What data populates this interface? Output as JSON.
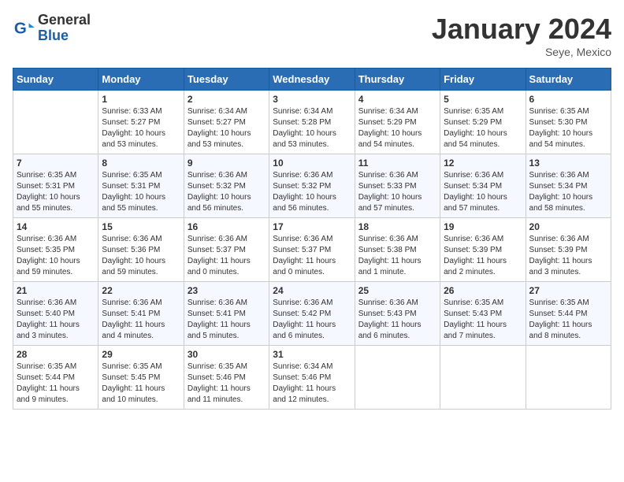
{
  "header": {
    "logo_line1": "General",
    "logo_line2": "Blue",
    "month_title": "January 2024",
    "location": "Seye, Mexico"
  },
  "days_of_week": [
    "Sunday",
    "Monday",
    "Tuesday",
    "Wednesday",
    "Thursday",
    "Friday",
    "Saturday"
  ],
  "weeks": [
    [
      {
        "day": "",
        "info": ""
      },
      {
        "day": "1",
        "info": "Sunrise: 6:33 AM\nSunset: 5:27 PM\nDaylight: 10 hours\nand 53 minutes."
      },
      {
        "day": "2",
        "info": "Sunrise: 6:34 AM\nSunset: 5:27 PM\nDaylight: 10 hours\nand 53 minutes."
      },
      {
        "day": "3",
        "info": "Sunrise: 6:34 AM\nSunset: 5:28 PM\nDaylight: 10 hours\nand 53 minutes."
      },
      {
        "day": "4",
        "info": "Sunrise: 6:34 AM\nSunset: 5:29 PM\nDaylight: 10 hours\nand 54 minutes."
      },
      {
        "day": "5",
        "info": "Sunrise: 6:35 AM\nSunset: 5:29 PM\nDaylight: 10 hours\nand 54 minutes."
      },
      {
        "day": "6",
        "info": "Sunrise: 6:35 AM\nSunset: 5:30 PM\nDaylight: 10 hours\nand 54 minutes."
      }
    ],
    [
      {
        "day": "7",
        "info": "Sunrise: 6:35 AM\nSunset: 5:31 PM\nDaylight: 10 hours\nand 55 minutes."
      },
      {
        "day": "8",
        "info": "Sunrise: 6:35 AM\nSunset: 5:31 PM\nDaylight: 10 hours\nand 55 minutes."
      },
      {
        "day": "9",
        "info": "Sunrise: 6:36 AM\nSunset: 5:32 PM\nDaylight: 10 hours\nand 56 minutes."
      },
      {
        "day": "10",
        "info": "Sunrise: 6:36 AM\nSunset: 5:32 PM\nDaylight: 10 hours\nand 56 minutes."
      },
      {
        "day": "11",
        "info": "Sunrise: 6:36 AM\nSunset: 5:33 PM\nDaylight: 10 hours\nand 57 minutes."
      },
      {
        "day": "12",
        "info": "Sunrise: 6:36 AM\nSunset: 5:34 PM\nDaylight: 10 hours\nand 57 minutes."
      },
      {
        "day": "13",
        "info": "Sunrise: 6:36 AM\nSunset: 5:34 PM\nDaylight: 10 hours\nand 58 minutes."
      }
    ],
    [
      {
        "day": "14",
        "info": "Sunrise: 6:36 AM\nSunset: 5:35 PM\nDaylight: 10 hours\nand 59 minutes."
      },
      {
        "day": "15",
        "info": "Sunrise: 6:36 AM\nSunset: 5:36 PM\nDaylight: 10 hours\nand 59 minutes."
      },
      {
        "day": "16",
        "info": "Sunrise: 6:36 AM\nSunset: 5:37 PM\nDaylight: 11 hours\nand 0 minutes."
      },
      {
        "day": "17",
        "info": "Sunrise: 6:36 AM\nSunset: 5:37 PM\nDaylight: 11 hours\nand 0 minutes."
      },
      {
        "day": "18",
        "info": "Sunrise: 6:36 AM\nSunset: 5:38 PM\nDaylight: 11 hours\nand 1 minute."
      },
      {
        "day": "19",
        "info": "Sunrise: 6:36 AM\nSunset: 5:39 PM\nDaylight: 11 hours\nand 2 minutes."
      },
      {
        "day": "20",
        "info": "Sunrise: 6:36 AM\nSunset: 5:39 PM\nDaylight: 11 hours\nand 3 minutes."
      }
    ],
    [
      {
        "day": "21",
        "info": "Sunrise: 6:36 AM\nSunset: 5:40 PM\nDaylight: 11 hours\nand 3 minutes."
      },
      {
        "day": "22",
        "info": "Sunrise: 6:36 AM\nSunset: 5:41 PM\nDaylight: 11 hours\nand 4 minutes."
      },
      {
        "day": "23",
        "info": "Sunrise: 6:36 AM\nSunset: 5:41 PM\nDaylight: 11 hours\nand 5 minutes."
      },
      {
        "day": "24",
        "info": "Sunrise: 6:36 AM\nSunset: 5:42 PM\nDaylight: 11 hours\nand 6 minutes."
      },
      {
        "day": "25",
        "info": "Sunrise: 6:36 AM\nSunset: 5:43 PM\nDaylight: 11 hours\nand 6 minutes."
      },
      {
        "day": "26",
        "info": "Sunrise: 6:35 AM\nSunset: 5:43 PM\nDaylight: 11 hours\nand 7 minutes."
      },
      {
        "day": "27",
        "info": "Sunrise: 6:35 AM\nSunset: 5:44 PM\nDaylight: 11 hours\nand 8 minutes."
      }
    ],
    [
      {
        "day": "28",
        "info": "Sunrise: 6:35 AM\nSunset: 5:44 PM\nDaylight: 11 hours\nand 9 minutes."
      },
      {
        "day": "29",
        "info": "Sunrise: 6:35 AM\nSunset: 5:45 PM\nDaylight: 11 hours\nand 10 minutes."
      },
      {
        "day": "30",
        "info": "Sunrise: 6:35 AM\nSunset: 5:46 PM\nDaylight: 11 hours\nand 11 minutes."
      },
      {
        "day": "31",
        "info": "Sunrise: 6:34 AM\nSunset: 5:46 PM\nDaylight: 11 hours\nand 12 minutes."
      },
      {
        "day": "",
        "info": ""
      },
      {
        "day": "",
        "info": ""
      },
      {
        "day": "",
        "info": ""
      }
    ]
  ]
}
